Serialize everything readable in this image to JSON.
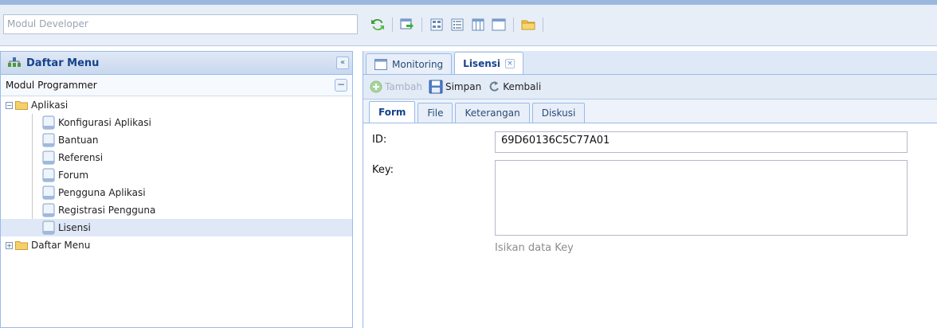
{
  "header": {
    "module_select": "Modul Developer",
    "toolbar_icons": [
      "refresh-icon",
      "export-icon",
      "tile-icon",
      "list-icon",
      "columns-icon",
      "window-icon",
      "folder-icon"
    ]
  },
  "sidebar": {
    "title": "Daftar Menu",
    "collapse_label": "«",
    "module_label": "Modul Programmer",
    "minus_label": "−",
    "tree": {
      "aplikasi": {
        "label": "Aplikasi",
        "expander": "−",
        "children": [
          "Konfigurasi Aplikasi",
          "Bantuan",
          "Referensi",
          "Forum",
          "Pengguna Aplikasi",
          "Registrasi Pengguna",
          "Lisensi"
        ]
      },
      "daftar_menu": {
        "label": "Daftar Menu",
        "expander": "+"
      }
    }
  },
  "main": {
    "tabs": [
      {
        "label": "Monitoring"
      },
      {
        "label": "Lisensi",
        "close": "×"
      }
    ],
    "actions": {
      "tambah": "Tambah",
      "simpan": "Simpan",
      "kembali": "Kembali"
    },
    "sub_tabs": [
      "Form",
      "File",
      "Keterangan",
      "Diskusi"
    ],
    "form": {
      "id_label": "ID:",
      "id_value": "69D60136C5C77A01",
      "key_label": "Key:",
      "key_value": "",
      "key_hint": "Isikan data Key"
    }
  },
  "colors": {
    "panel_header_text": "#15428b",
    "border": "#99bbe8",
    "selected_row": "#dfe8f6"
  }
}
